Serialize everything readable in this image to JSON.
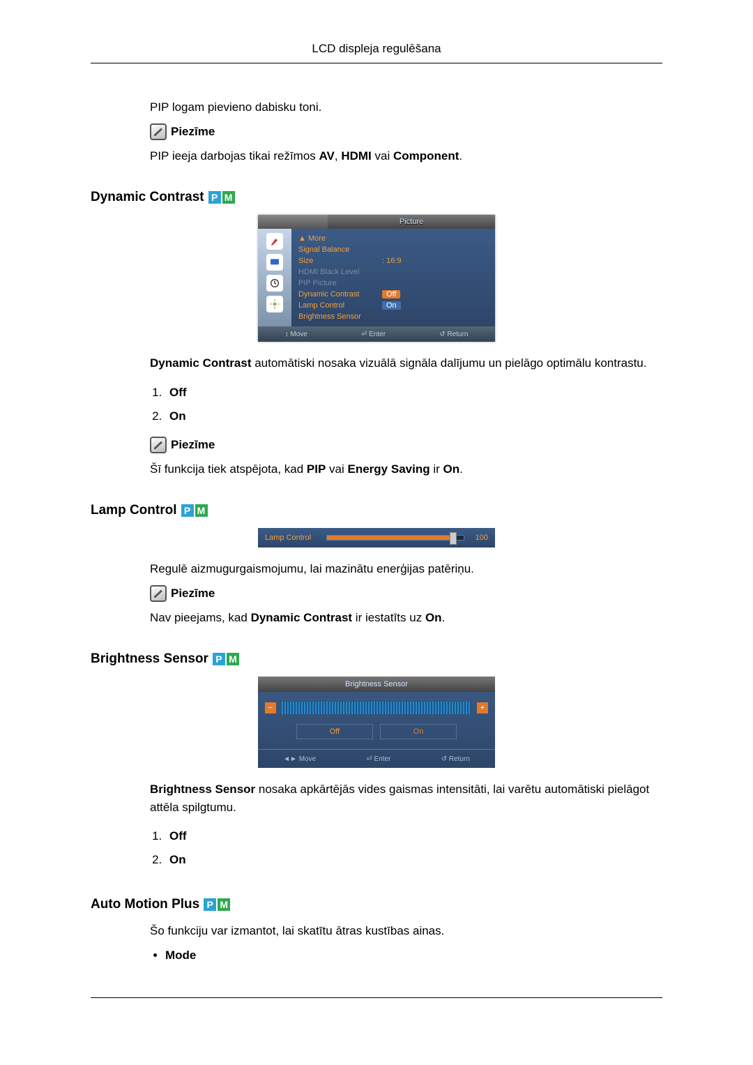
{
  "header": {
    "title": "LCD displeja regulēšana"
  },
  "intro": {
    "pip_tone": "PIP logam pievieno dabisku toni.",
    "note_label": "Piezīme",
    "pip_input_pre": "PIP ieeja darbojas tikai režīmos ",
    "pip_input_modes_1": "AV",
    "pip_input_sep": ", ",
    "pip_input_modes_2": "HDMI",
    "pip_input_or": " vai ",
    "pip_input_modes_3": "Component",
    "pip_input_end": "."
  },
  "dynamic_contrast": {
    "title": "Dynamic Contrast",
    "desc_pre": "Dynamic Contrast",
    "desc_post": " automātiski nosaka vizuālā signāla dalījumu un pielāgo optimālu kontrastu.",
    "options": {
      "off": "Off",
      "on": "On"
    },
    "note_label": "Piezīme",
    "note_text_pre": "Šī funkcija tiek atspējota, kad ",
    "note_text_pip": "PIP",
    "note_text_mid": " vai ",
    "note_text_es": "Energy Saving",
    "note_text_post": " ir ",
    "note_text_on": "On",
    "note_text_end": "."
  },
  "osd_menu": {
    "tab": "Picture",
    "rows": {
      "more": "▲ More",
      "signal_balance": "Signal Balance",
      "size": "Size",
      "size_val": "16:9",
      "hdmi_black": "HDMI Black Level",
      "pip_picture": "PIP Picture",
      "dyn_contrast": "Dynamic Contrast",
      "dyn_contrast_val": "Off",
      "lamp_control": "Lamp Control",
      "lamp_control_val": "On",
      "brightness_sensor": "Brightness Sensor"
    },
    "footer": {
      "move": "Move",
      "enter": "Enter",
      "return": "Return"
    }
  },
  "lamp_control": {
    "title": "Lamp Control",
    "slider_label": "Lamp Control",
    "slider_value": "100",
    "desc": "Regulē aizmugurgaismojumu, lai mazinātu enerģijas patēriņu.",
    "note_label": "Piezīme",
    "note_pre": "Nav pieejams, kad ",
    "note_dc": "Dynamic Contrast",
    "note_mid": " ir iestatīts uz ",
    "note_on": "On",
    "note_end": "."
  },
  "brightness_sensor": {
    "title": "Brightness Sensor",
    "panel_title": "Brightness Sensor",
    "off": "Off",
    "on": "On",
    "footer": {
      "move": "Move",
      "enter": "Enter",
      "return": "Return"
    },
    "desc_pre": "Brightness Sensor",
    "desc_post": " nosaka apkārtējās vides gaismas intensitāti, lai varētu automātiski pielāgot attēla spilgtumu.",
    "options": {
      "off": "Off",
      "on": "On"
    }
  },
  "auto_motion_plus": {
    "title": "Auto Motion Plus",
    "desc": "Šo funkciju var izmantot, lai skatītu ātras kustības ainas.",
    "bullet": "Mode"
  },
  "badges": {
    "p": "P",
    "m": "M"
  }
}
